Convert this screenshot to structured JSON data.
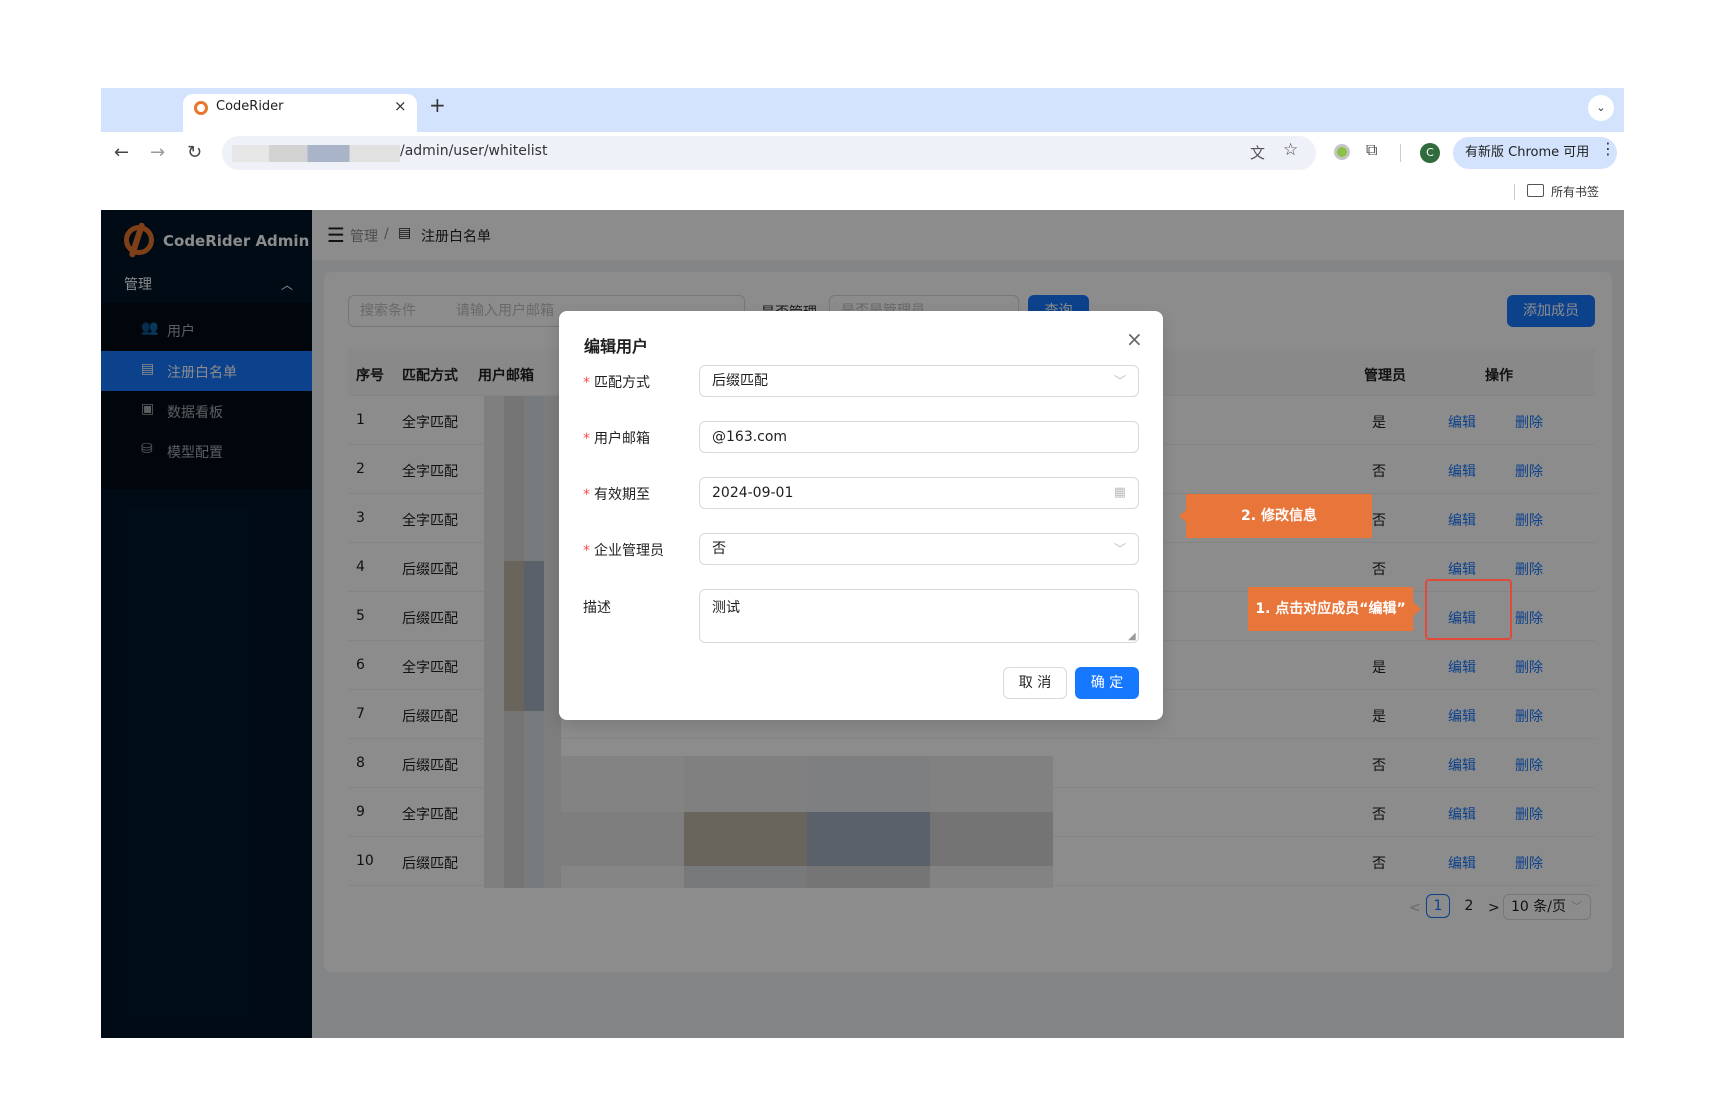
{
  "browser": {
    "tab_title": "CodeRider",
    "tab_close": "×",
    "new_tab": "+",
    "tab_dropdown": "⌄",
    "url_path": "/admin/user/whitelist",
    "update_chip": "有新版 Chrome 可用",
    "profile_initial": "C",
    "bookmarks_label": "所有书签",
    "icons": [
      "back-icon",
      "forward-icon",
      "reload-icon",
      "translate-icon",
      "star-icon",
      "extension-icon",
      "puzzle-icon",
      "more-icon",
      "folder-icon"
    ]
  },
  "app": {
    "title": "CodeRider Admin",
    "menu_group": "管理",
    "menu_items": [
      {
        "label": "用户",
        "icon": "users-icon"
      },
      {
        "label": "注册白名单",
        "icon": "form-icon"
      },
      {
        "label": "数据看板",
        "icon": "dashboard-icon"
      },
      {
        "label": "模型配置",
        "icon": "database-icon"
      }
    ],
    "active_menu": "注册白名单",
    "breadcrumb": [
      "管理",
      "注册白名单"
    ],
    "breadcrumb_sep": "/"
  },
  "filters": {
    "select_placeholder": "搜索条件",
    "input_placeholder": "请输入用户邮箱",
    "admin_label": "是否管理",
    "admin_placeholder": "是否是管理员",
    "query_button": "查询",
    "add_button": "添加成员"
  },
  "table": {
    "headers": {
      "index": "序号",
      "match": "匹配方式",
      "email": "用户邮箱",
      "admin": "管理员",
      "actions": "操作"
    },
    "edit_label": "编辑",
    "delete_label": "删除",
    "rows": [
      {
        "index": "1",
        "match": "全字匹配",
        "admin": "是"
      },
      {
        "index": "2",
        "match": "全字匹配",
        "admin": "否"
      },
      {
        "index": "3",
        "match": "全字匹配",
        "admin": "否"
      },
      {
        "index": "4",
        "match": "后缀匹配",
        "admin": "否"
      },
      {
        "index": "5",
        "match": "后缀匹配",
        "admin": "否"
      },
      {
        "index": "6",
        "match": "全字匹配",
        "admin": "是"
      },
      {
        "index": "7",
        "match": "后缀匹配",
        "admin": "是"
      },
      {
        "index": "8",
        "match": "后缀匹配",
        "admin": "否"
      },
      {
        "index": "9",
        "match": "全字匹配",
        "admin": "否"
      },
      {
        "index": "10",
        "match": "后缀匹配",
        "admin": "否"
      }
    ]
  },
  "pagination": {
    "prev": "<",
    "pages": [
      "1",
      "2"
    ],
    "current": "1",
    "next": ">",
    "page_size": "10 条/页"
  },
  "modal": {
    "title": "编辑用户",
    "close": "×",
    "fields": [
      {
        "label": "匹配方式",
        "required": true,
        "value": "后缀匹配",
        "type": "select"
      },
      {
        "label": "用户邮箱",
        "required": true,
        "value": "@163.com",
        "type": "input"
      },
      {
        "label": "有效期至",
        "required": true,
        "value": "2024-09-01",
        "type": "date"
      },
      {
        "label": "企业管理员",
        "required": true,
        "value": "否",
        "type": "select"
      },
      {
        "label": "描述",
        "required": false,
        "value": "测试",
        "type": "textarea"
      }
    ],
    "required_mark": "*",
    "cancel": "取 消",
    "ok": "确 定"
  },
  "annotations": {
    "step1": "1. 点击对应成员“编辑”",
    "step2": "2. 修改信息",
    "callout_color": "#e8763a",
    "highlight_color": "#e04a3a"
  },
  "colors": {
    "primary": "#1677ff",
    "sider": "#001529",
    "chrome": "#d3e3fd"
  }
}
